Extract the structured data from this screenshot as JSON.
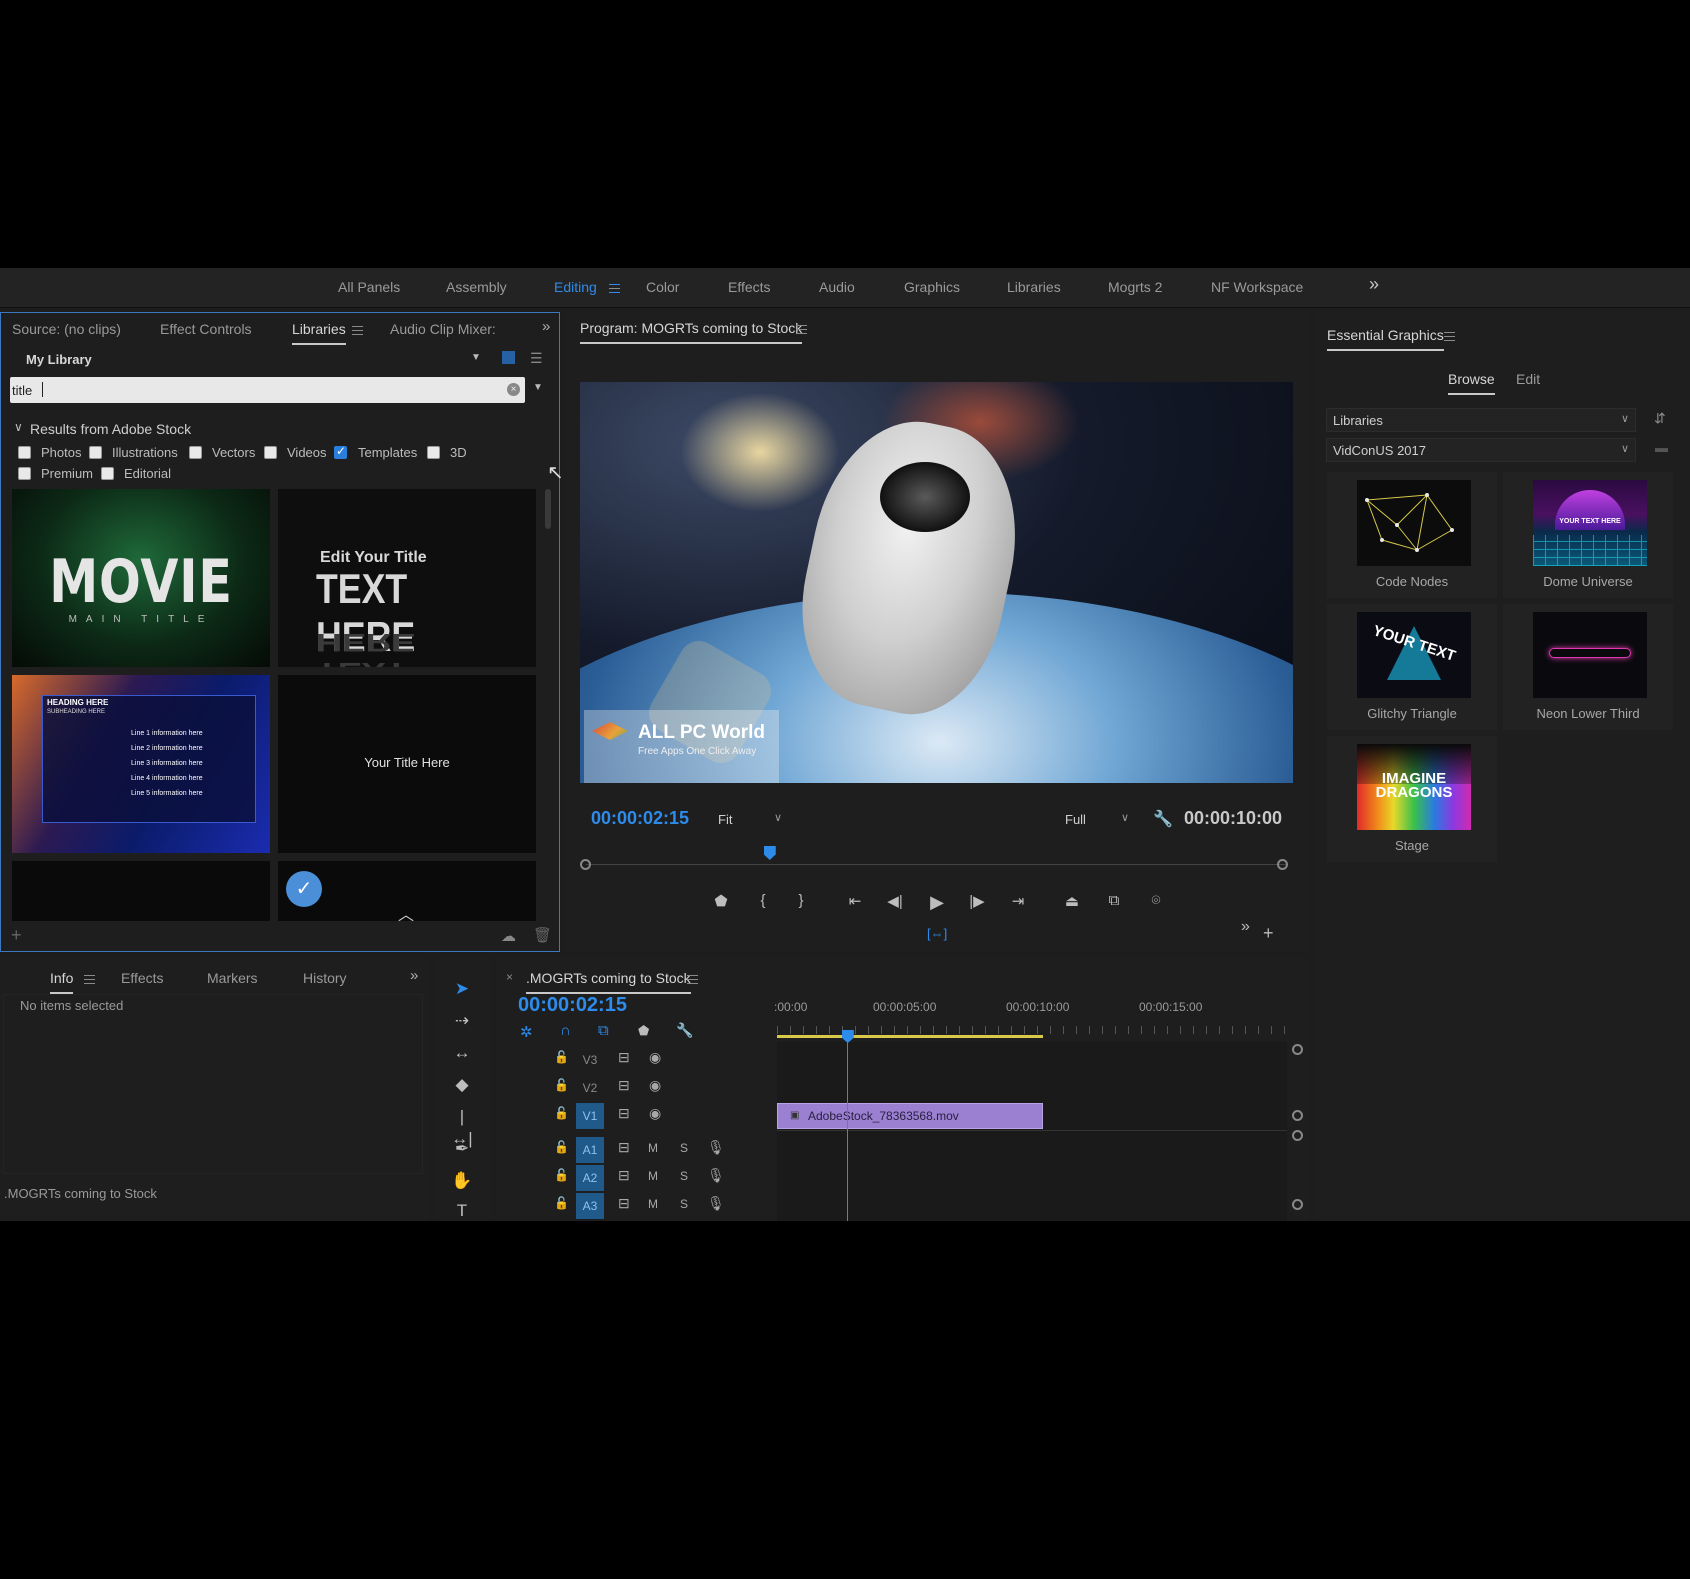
{
  "workspaces": {
    "items": [
      "All Panels",
      "Assembly",
      "Editing",
      "Color",
      "Effects",
      "Audio",
      "Graphics",
      "Libraries",
      "Mogrts 2",
      "NF Workspace"
    ],
    "overflow": "»"
  },
  "source_panel": {
    "tabs": [
      "Source: (no clips)",
      "Effect Controls",
      "Libraries",
      "Audio Clip Mixer:"
    ],
    "library_select": "My Library",
    "search_value": "title",
    "results_header": "Results from Adobe Stock",
    "filters": [
      {
        "label": "Photos",
        "checked": false
      },
      {
        "label": "Illustrations",
        "checked": false
      },
      {
        "label": "Vectors",
        "checked": false
      },
      {
        "label": "Videos",
        "checked": false
      },
      {
        "label": "Templates",
        "checked": true
      },
      {
        "label": "3D",
        "checked": false
      },
      {
        "label": "Premium",
        "checked": false
      },
      {
        "label": "Editorial",
        "checked": false
      }
    ],
    "thumbs": {
      "movie_title": "MOVIE",
      "movie_sub": "MAIN TITLE",
      "edit_title": "Edit Your Title",
      "text_here": "TEXT HERE",
      "heading": "HEADING HERE",
      "subheading": "SUBHEADING HERE",
      "lines": [
        "Line 1 information here",
        "Line 2 information here",
        "Line 3 information here",
        "Line 4 information here",
        "Line 5 information here"
      ],
      "your_title": "Your Title Here"
    }
  },
  "program_monitor": {
    "title": "Program: MOGRTs coming to Stock",
    "current_time": "00:00:02:15",
    "fit": "Fit",
    "quality": "Full",
    "duration": "00:00:10:00",
    "watermark_title": "ALL PC World",
    "watermark_sub": "Free Apps One Click Away"
  },
  "essential_graphics": {
    "title": "Essential Graphics",
    "tabs": [
      "Browse",
      "Edit"
    ],
    "source_select": "Libraries",
    "library_select": "VidConUS 2017",
    "items": [
      "Code Nodes",
      "Dome Universe",
      "Glitchy Triangle",
      "Neon Lower Third",
      "Stage"
    ],
    "dome_text": "YOUR TEXT HERE",
    "glitch_text": "YOUR TEXT",
    "stage_text1": "IMAGINE",
    "stage_text2": "DRAGONS"
  },
  "info_panel": {
    "tabs": [
      "Info",
      "Effects",
      "Markers",
      "History"
    ],
    "status": "No items selected",
    "sequence": ".MOGRTs coming to Stock"
  },
  "timeline": {
    "sequence_name": ".MOGRTs coming to Stock",
    "current_time": "00:00:02:15",
    "ruler": [
      ":00:00",
      "00:00:05:00",
      "00:00:10:00",
      "00:00:15:00"
    ],
    "video_tracks": [
      "V3",
      "V2",
      "V1"
    ],
    "audio_tracks": [
      "A1",
      "A2",
      "A3"
    ],
    "clip_name": "AdobeStock_78363568.mov",
    "mute_label": "M",
    "solo_label": "S",
    "playhead_seconds": 2.625,
    "clip_end_seconds": 10
  },
  "colors": {
    "accent": "#2d8ceb",
    "clip": "#9b7fd1",
    "work_area": "#d8c94a"
  }
}
